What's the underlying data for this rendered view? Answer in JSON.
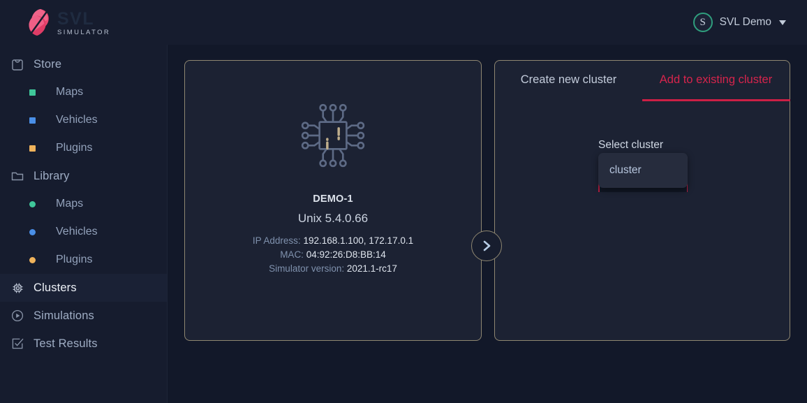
{
  "topbar": {
    "brand_title": "SVL",
    "brand_subtitle": "SIMULATOR",
    "logo_icon": "svl-leaf-logo",
    "user": {
      "avatar_initial": "S",
      "name": "SVL Demo",
      "caret_icon": "chevron-down-icon"
    }
  },
  "sidebar": {
    "groups": [
      {
        "label": "Store",
        "icon": "shopping-bag-icon",
        "active": false,
        "items": [
          {
            "label": "Maps",
            "marker": "square",
            "color": "#3fc79a"
          },
          {
            "label": "Vehicles",
            "marker": "square",
            "color": "#4a8fe7"
          },
          {
            "label": "Plugins",
            "marker": "square",
            "color": "#f0b35b"
          }
        ]
      },
      {
        "label": "Library",
        "icon": "folder-icon",
        "active": false,
        "items": [
          {
            "label": "Maps",
            "marker": "circle",
            "color": "#3fc79a"
          },
          {
            "label": "Vehicles",
            "marker": "circle",
            "color": "#4a8fe7"
          },
          {
            "label": "Plugins",
            "marker": "circle",
            "color": "#f0b35b"
          }
        ]
      }
    ],
    "links": [
      {
        "label": "Clusters",
        "icon": "cpu-chip-icon",
        "active": true
      },
      {
        "label": "Simulations",
        "icon": "play-circle-icon",
        "active": false
      },
      {
        "label": "Test Results",
        "icon": "check-square-icon",
        "active": false
      }
    ]
  },
  "main": {
    "node_card": {
      "icon": "cpu-chip-large-icon",
      "name": "DEMO-1",
      "os": "Unix 5.4.0.66",
      "details": [
        {
          "key": "IP Address:",
          "value": "192.168.1.100, 172.17.0.1"
        },
        {
          "key": "MAC:",
          "value": "04:92:26:D8:BB:14"
        },
        {
          "key": "Simulator version:",
          "value": "2021.1-rc17"
        }
      ]
    },
    "arrow_button": {
      "icon": "chevron-right-icon"
    },
    "cluster_card": {
      "tabs": [
        {
          "label": "Create new cluster",
          "active": false
        },
        {
          "label": "Add to existing cluster",
          "active": true
        }
      ],
      "select": {
        "label": "Select cluster",
        "value": "",
        "caret_icon": "chevron-up-icon",
        "options": [
          "cluster"
        ]
      }
    }
  },
  "colors": {
    "accent_crimson": "#cc1f45",
    "page_bg": "#121829",
    "panel_bg": "#161c2e",
    "card_bg": "#1c2233",
    "card_border": "#8f8771",
    "avatar_ring": "#2f9e7d"
  }
}
